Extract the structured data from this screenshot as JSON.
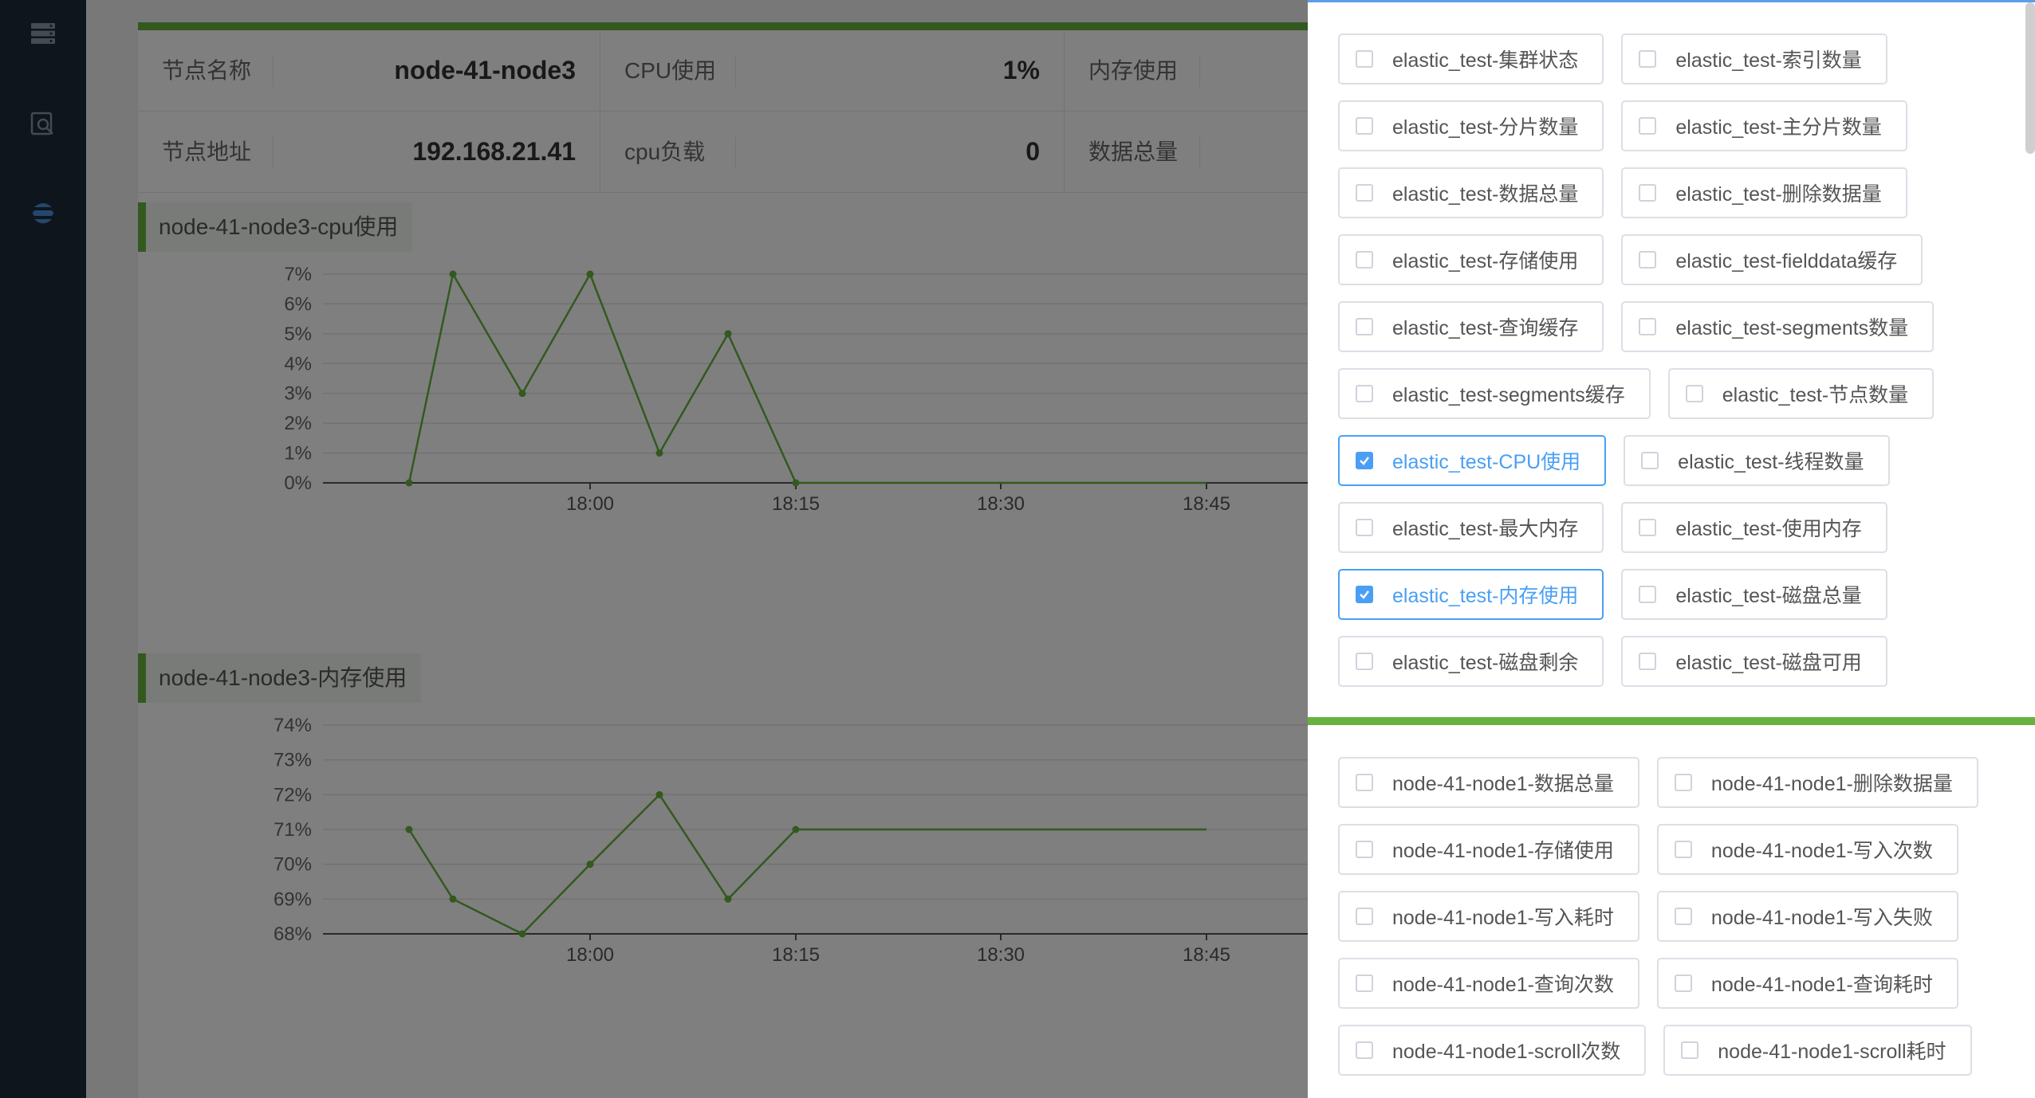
{
  "sidebar": {
    "icons": [
      "server-icon",
      "search-document-icon",
      "elastic-icon"
    ]
  },
  "info": {
    "row1": {
      "node_name_label": "节点名称",
      "node_name_value": "node-41-node3",
      "cpu_label": "CPU使用",
      "cpu_value": "1%",
      "mem_label": "内存使用"
    },
    "row2": {
      "addr_label": "节点地址",
      "addr_value": "192.168.21.41",
      "load_label": "cpu负载",
      "load_value": "0",
      "docs_label": "数据总量"
    }
  },
  "chart_data": [
    {
      "type": "line",
      "title": "node-41-node3-cpu使用",
      "x": [
        "17:47",
        "17:50",
        "17:55",
        "18:00",
        "18:05",
        "18:10",
        "18:15",
        "18:30",
        "18:45"
      ],
      "values": [
        0,
        7,
        3,
        7,
        1,
        5,
        0,
        0,
        0
      ],
      "ylim": [
        0,
        7
      ],
      "yticks": [
        "0%",
        "1%",
        "2%",
        "3%",
        "4%",
        "5%",
        "6%",
        "7%"
      ],
      "xticks": [
        "18:00",
        "18:15",
        "18:30",
        "18:45"
      ],
      "color": "#67b23f"
    },
    {
      "type": "line",
      "title": "node-41-node3-内存使用",
      "x": [
        "17:47",
        "17:50",
        "17:55",
        "18:00",
        "18:05",
        "18:10",
        "18:15",
        "18:30",
        "18:45"
      ],
      "values": [
        71,
        69,
        68,
        70,
        72,
        69,
        71,
        71,
        71
      ],
      "ylim": [
        68,
        74
      ],
      "yticks": [
        "68%",
        "69%",
        "70%",
        "71%",
        "72%",
        "73%",
        "74%"
      ],
      "xticks": [
        "18:00",
        "18:15",
        "18:30",
        "18:45"
      ],
      "color": "#67b23f"
    }
  ],
  "drawer": {
    "section1": [
      {
        "label": "elastic_test-集群状态",
        "checked": false
      },
      {
        "label": "elastic_test-索引数量",
        "checked": false
      },
      {
        "label": "elastic_test-分片数量",
        "checked": false
      },
      {
        "label": "elastic_test-主分片数量",
        "checked": false
      },
      {
        "label": "elastic_test-数据总量",
        "checked": false
      },
      {
        "label": "elastic_test-删除数据量",
        "checked": false
      },
      {
        "label": "elastic_test-存储使用",
        "checked": false
      },
      {
        "label": "elastic_test-fielddata缓存",
        "checked": false
      },
      {
        "label": "elastic_test-查询缓存",
        "checked": false
      },
      {
        "label": "elastic_test-segments数量",
        "checked": false
      },
      {
        "label": "elastic_test-segments缓存",
        "checked": false
      },
      {
        "label": "elastic_test-节点数量",
        "checked": false
      },
      {
        "label": "elastic_test-CPU使用",
        "checked": true
      },
      {
        "label": "elastic_test-线程数量",
        "checked": false
      },
      {
        "label": "elastic_test-最大内存",
        "checked": false
      },
      {
        "label": "elastic_test-使用内存",
        "checked": false
      },
      {
        "label": "elastic_test-内存使用",
        "checked": true
      },
      {
        "label": "elastic_test-磁盘总量",
        "checked": false
      },
      {
        "label": "elastic_test-磁盘剩余",
        "checked": false
      },
      {
        "label": "elastic_test-磁盘可用",
        "checked": false
      }
    ],
    "section2": [
      {
        "label": "node-41-node1-数据总量",
        "checked": false
      },
      {
        "label": "node-41-node1-删除数据量",
        "checked": false
      },
      {
        "label": "node-41-node1-存储使用",
        "checked": false
      },
      {
        "label": "node-41-node1-写入次数",
        "checked": false
      },
      {
        "label": "node-41-node1-写入耗时",
        "checked": false
      },
      {
        "label": "node-41-node1-写入失败",
        "checked": false
      },
      {
        "label": "node-41-node1-查询次数",
        "checked": false
      },
      {
        "label": "node-41-node1-查询耗时",
        "checked": false
      },
      {
        "label": "node-41-node1-scroll次数",
        "checked": false
      },
      {
        "label": "node-41-node1-scroll耗时",
        "checked": false
      }
    ]
  },
  "colors": {
    "accent": "#67b23f",
    "checked": "#4a9ff5",
    "sidebar": "#1c2a3a"
  }
}
